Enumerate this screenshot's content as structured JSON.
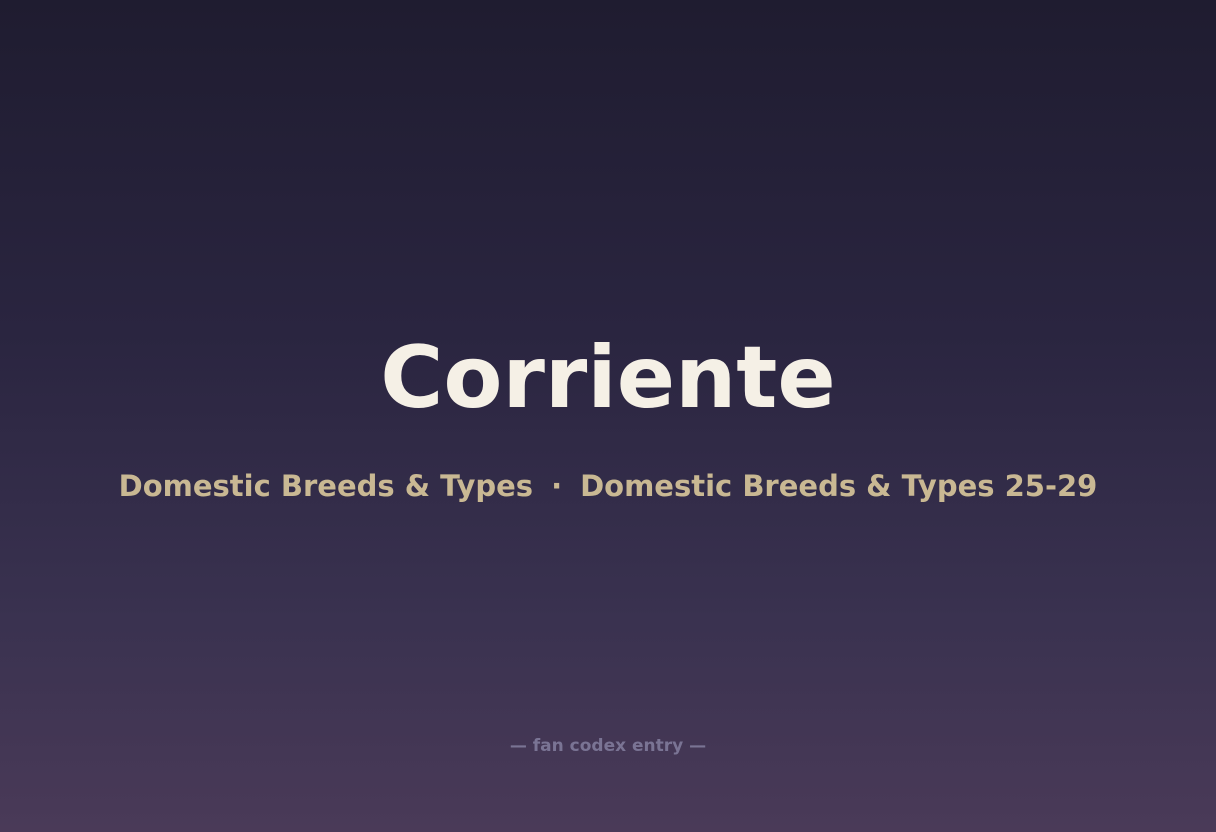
{
  "entry": {
    "title": "Corriente",
    "category": "Domestic Breeds & Types",
    "separator": "·",
    "subcategory": "Domestic Breeds & Types 25-29",
    "footer": "— fan codex entry —"
  },
  "colors": {
    "title": "#f5f0e6",
    "subtitle": "#c9b893",
    "footer": "#7a7494",
    "background_top": "#1f1c30",
    "background_bottom": "#4a3a58"
  }
}
